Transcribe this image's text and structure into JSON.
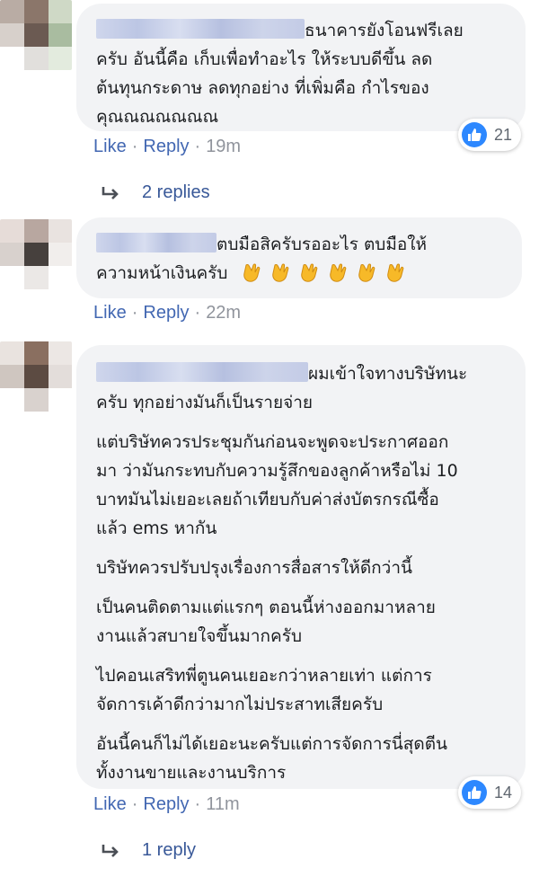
{
  "comments": [
    {
      "text": "ธนาคารยังโอนฟรีเลยครับ อันนี้คือ เก็บเพื่อทำอะไร ให้ระบบดีขึ้น ลดต้นทุนกระดาษ ลดทุกอย่าง ที่เพิ่มคือ กำไรของคุณณณณณณณ",
      "line1": "ธนาคารยังโอนฟรีเลย",
      "line2": "ครับ อันนี้คือ เก็บเพื่อทำอะไร ให้ระบบดีขึ้น ลด",
      "line3": "ต้นทุนกระดาษ ลดทุกอย่าง ที่เพิ่มคือ กำไรของ",
      "line4": "คุณณณณณณณ",
      "like": "Like",
      "reply": "Reply",
      "time": "19m",
      "reaction_count": "21",
      "replies_label": "2 replies"
    },
    {
      "line1": "ตบมือสิครับรออะไร ตบมือให้",
      "line2": "ความหน้าเงินครับ",
      "emoji": "clapping-hands",
      "emoji_count": 6,
      "like": "Like",
      "reply": "Reply",
      "time": "22m"
    },
    {
      "p1_line1": "ผมเข้าใจทางบริษัทนะ",
      "p1_line2": "ครับ ทุกอย่างมันก็เป็นรายจ่าย",
      "p2_line1": "แต่บริษัทควรประชุมกันก่อนจะพูดจะประกาศออก",
      "p2_line2": "มา ว่ามันกระทบกับความรู้สึกของลูกค้าหรือไม่ 10",
      "p2_line3": "บาทมันไม่เยอะเลยถ้าเทียบกับค่าส่งบัตรกรณีซื้อ",
      "p2_line4": "แล้ว ems หากัน",
      "p3_line1": "บริษัทควรปรับปรุงเรื่องการสื่อสารให้ดีกว่านี้",
      "p4_line1": "เป็นคนติดตามแต่แรกๆ ตอนนี้ห่างออกมาหลาย",
      "p4_line2": "งานแล้วสบายใจขึ้นมากครับ",
      "p5_line1": "ไปคอนเสริทพี่ตูนคนเยอะกว่าหลายเท่า แต่การ",
      "p5_line2": "จัดการเค้าดีกว่ามากไม่ประสาทเสียครับ",
      "p6_line1": "อันนี้คนก็ไม่ได้เยอะนะครับแต่การจัดการนี่สุดตีน",
      "p6_line2": "ทั้งงานขายและงานบริการ",
      "like": "Like",
      "reply": "Reply",
      "time": "11m",
      "reaction_count": "14",
      "replies_label": "1 reply"
    }
  ],
  "separator": "·",
  "colors": {
    "bubble": "#f2f3f5",
    "link": "#4267b2",
    "meta": "#90949c",
    "replies": "#385898",
    "like_blue": "#2d88ff"
  }
}
